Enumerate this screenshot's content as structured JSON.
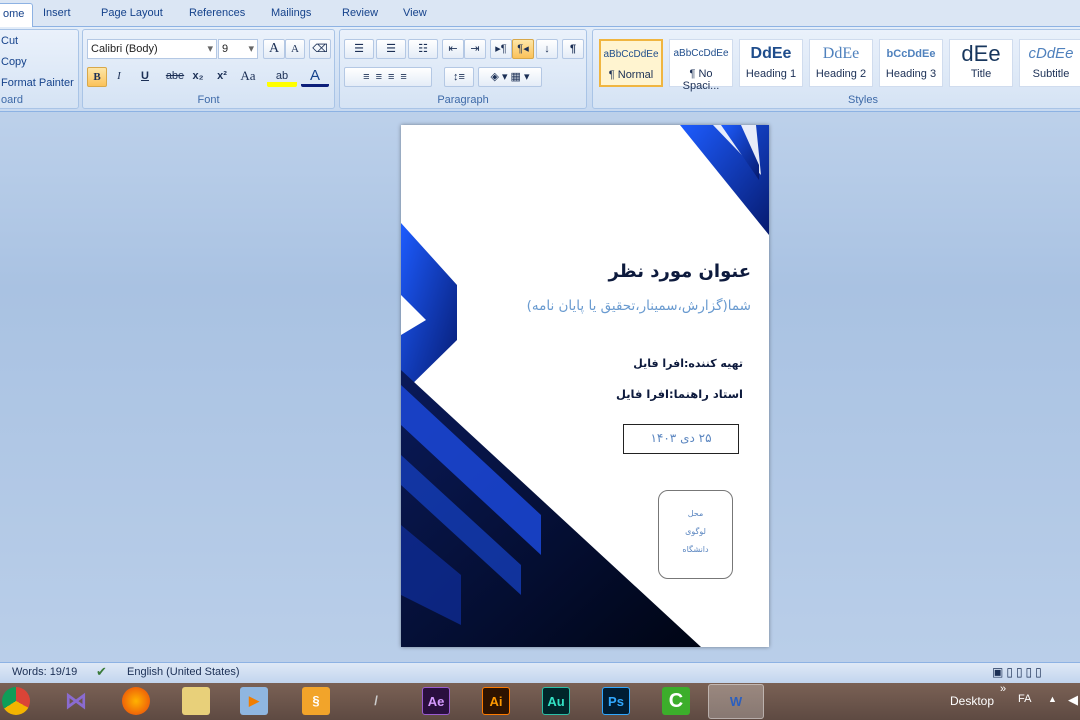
{
  "tabs": [
    "ome",
    "Insert",
    "Page Layout",
    "References",
    "Mailings",
    "Review",
    "View"
  ],
  "clipboard": {
    "cut": "Cut",
    "copy": "Copy",
    "format_painter": "Format Painter",
    "label": "oard"
  },
  "font": {
    "name": "Calibri (Body)",
    "size": "9",
    "label": "Font",
    "bold": "B",
    "italic": "I",
    "underline": "U",
    "strike": "abe",
    "sub": "x₂",
    "sup": "x²",
    "case": "Aa",
    "grow": "A",
    "shrink": "A",
    "color_letter": "A"
  },
  "paragraph": {
    "label": "Paragraph",
    "pilcrow": "¶"
  },
  "styles": {
    "label": "Styles",
    "items": [
      {
        "preview": "aBbCcDdEe",
        "name": "¶ Normal",
        "selected": true
      },
      {
        "preview": "aBbCcDdEe",
        "name": "¶ No Spaci..."
      },
      {
        "preview": "DdEe",
        "name": "Heading 1"
      },
      {
        "preview": "DdEe",
        "name": "Heading 2"
      },
      {
        "preview": "bCcDdEe",
        "name": "Heading 3"
      },
      {
        "preview": "dEe",
        "name": "Title"
      },
      {
        "preview": "cDdEe",
        "name": "Subtitle"
      }
    ]
  },
  "document": {
    "title": "عنوان مورد نظر",
    "subtitle": "شما(گزارش،سمینار،تحقیق یا پایان نامه)",
    "prepared_by": "تهیه کننده:افرا فایل",
    "advisor": "استاد راهنما:افرا فایل",
    "date": "۲۵ دی ۱۴۰۳",
    "logo_lines": [
      "محل",
      "لوگوی",
      "دانشگاه"
    ]
  },
  "status": {
    "words": "Words: 19/19",
    "language": "English (United States)"
  },
  "taskbar": {
    "apps": [
      "Chrome",
      "Visual Studio",
      "Firefox",
      "Explorer",
      "Media Player",
      "Sticky",
      "Mic",
      "Ae",
      "Ai",
      "Au",
      "Ps",
      "Camtasia",
      "Word"
    ],
    "desktop": "Desktop",
    "lang": "FA",
    "chevron": "»"
  },
  "colors": {
    "accent": "#1d4fd8",
    "navy": "#03081f",
    "ribbon": "#dbe6f4"
  }
}
